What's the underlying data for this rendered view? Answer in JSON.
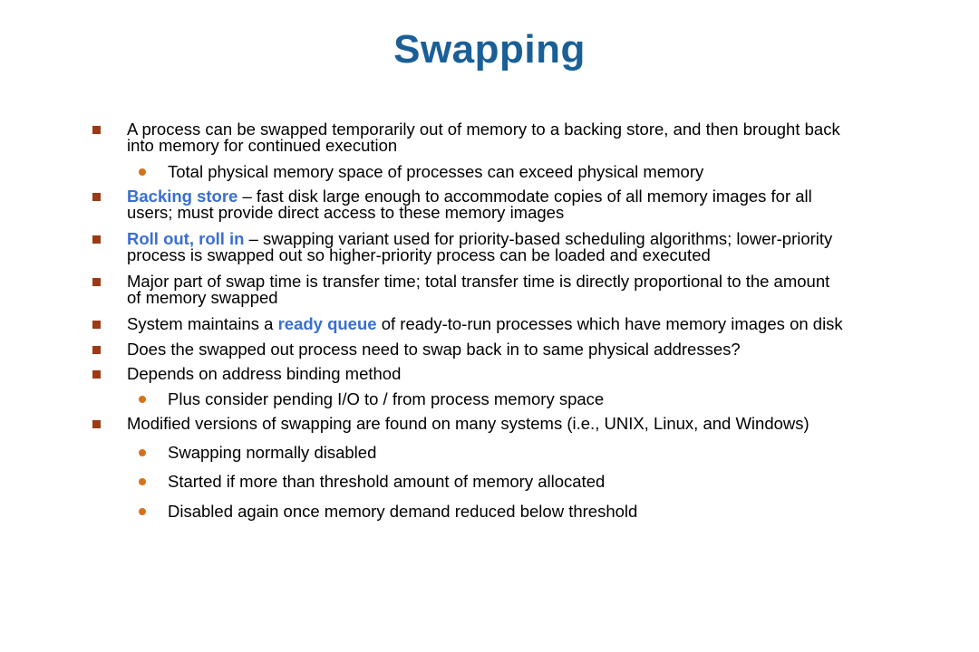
{
  "slide": {
    "title": "Swapping",
    "bullets": [
      {
        "level": 1,
        "parts": [
          {
            "text": "A process can be swapped temporarily out of memory to a backing store, and then brought back\ninto memory for continued execution",
            "highlight": false
          }
        ]
      },
      {
        "level": 2,
        "parts": [
          {
            "text": "Total physical memory space of processes can exceed physical memory",
            "highlight": false
          }
        ]
      },
      {
        "level": 1,
        "parts": [
          {
            "text": "Backing store",
            "highlight": true
          },
          {
            "text": " – fast disk large enough to accommodate copies of all memory images for all\nusers; must provide direct access to these memory images",
            "highlight": false
          }
        ]
      },
      {
        "level": 1,
        "parts": [
          {
            "text": "Roll out, roll in",
            "highlight": true
          },
          {
            "text": " – swapping variant used for priority-based scheduling algorithms; lower-priority\nprocess is swapped out so higher-priority process can be loaded and executed",
            "highlight": false
          }
        ]
      },
      {
        "level": 1,
        "parts": [
          {
            "text": "Major part of swap time is transfer time; total transfer time is directly proportional to the amount\nof memory swapped",
            "highlight": false
          }
        ]
      },
      {
        "level": 1,
        "parts": [
          {
            "text": "System maintains a ",
            "highlight": false
          },
          {
            "text": "ready queue",
            "highlight": true
          },
          {
            "text": " of ready-to-run processes which have memory images on disk",
            "highlight": false
          }
        ]
      },
      {
        "level": 1,
        "parts": [
          {
            "text": "Does the swapped out process need to swap back in to same physical addresses?",
            "highlight": false
          }
        ]
      },
      {
        "level": 1,
        "parts": [
          {
            "text": "Depends on address binding method",
            "highlight": false
          }
        ]
      },
      {
        "level": 2,
        "parts": [
          {
            "text": "Plus consider pending I/O to / from process memory space",
            "highlight": false
          }
        ]
      },
      {
        "level": 1,
        "parts": [
          {
            "text": "Modified versions of swapping are found on many systems (i.e., UNIX, Linux, and Windows)",
            "highlight": false
          }
        ]
      },
      {
        "level": 2,
        "parts": [
          {
            "text": "Swapping normally disabled",
            "highlight": false
          }
        ]
      },
      {
        "level": 2,
        "parts": [
          {
            "text": "Started if more than threshold amount of memory allocated",
            "highlight": false
          }
        ]
      },
      {
        "level": 2,
        "parts": [
          {
            "text": "Disabled again once memory demand reduced below threshold",
            "highlight": false
          }
        ]
      }
    ]
  },
  "colors": {
    "title": "#1a5f96",
    "highlight": "#3a6fd0",
    "square_bullet": "#9b3a14",
    "round_bullet": "#d4721e"
  }
}
